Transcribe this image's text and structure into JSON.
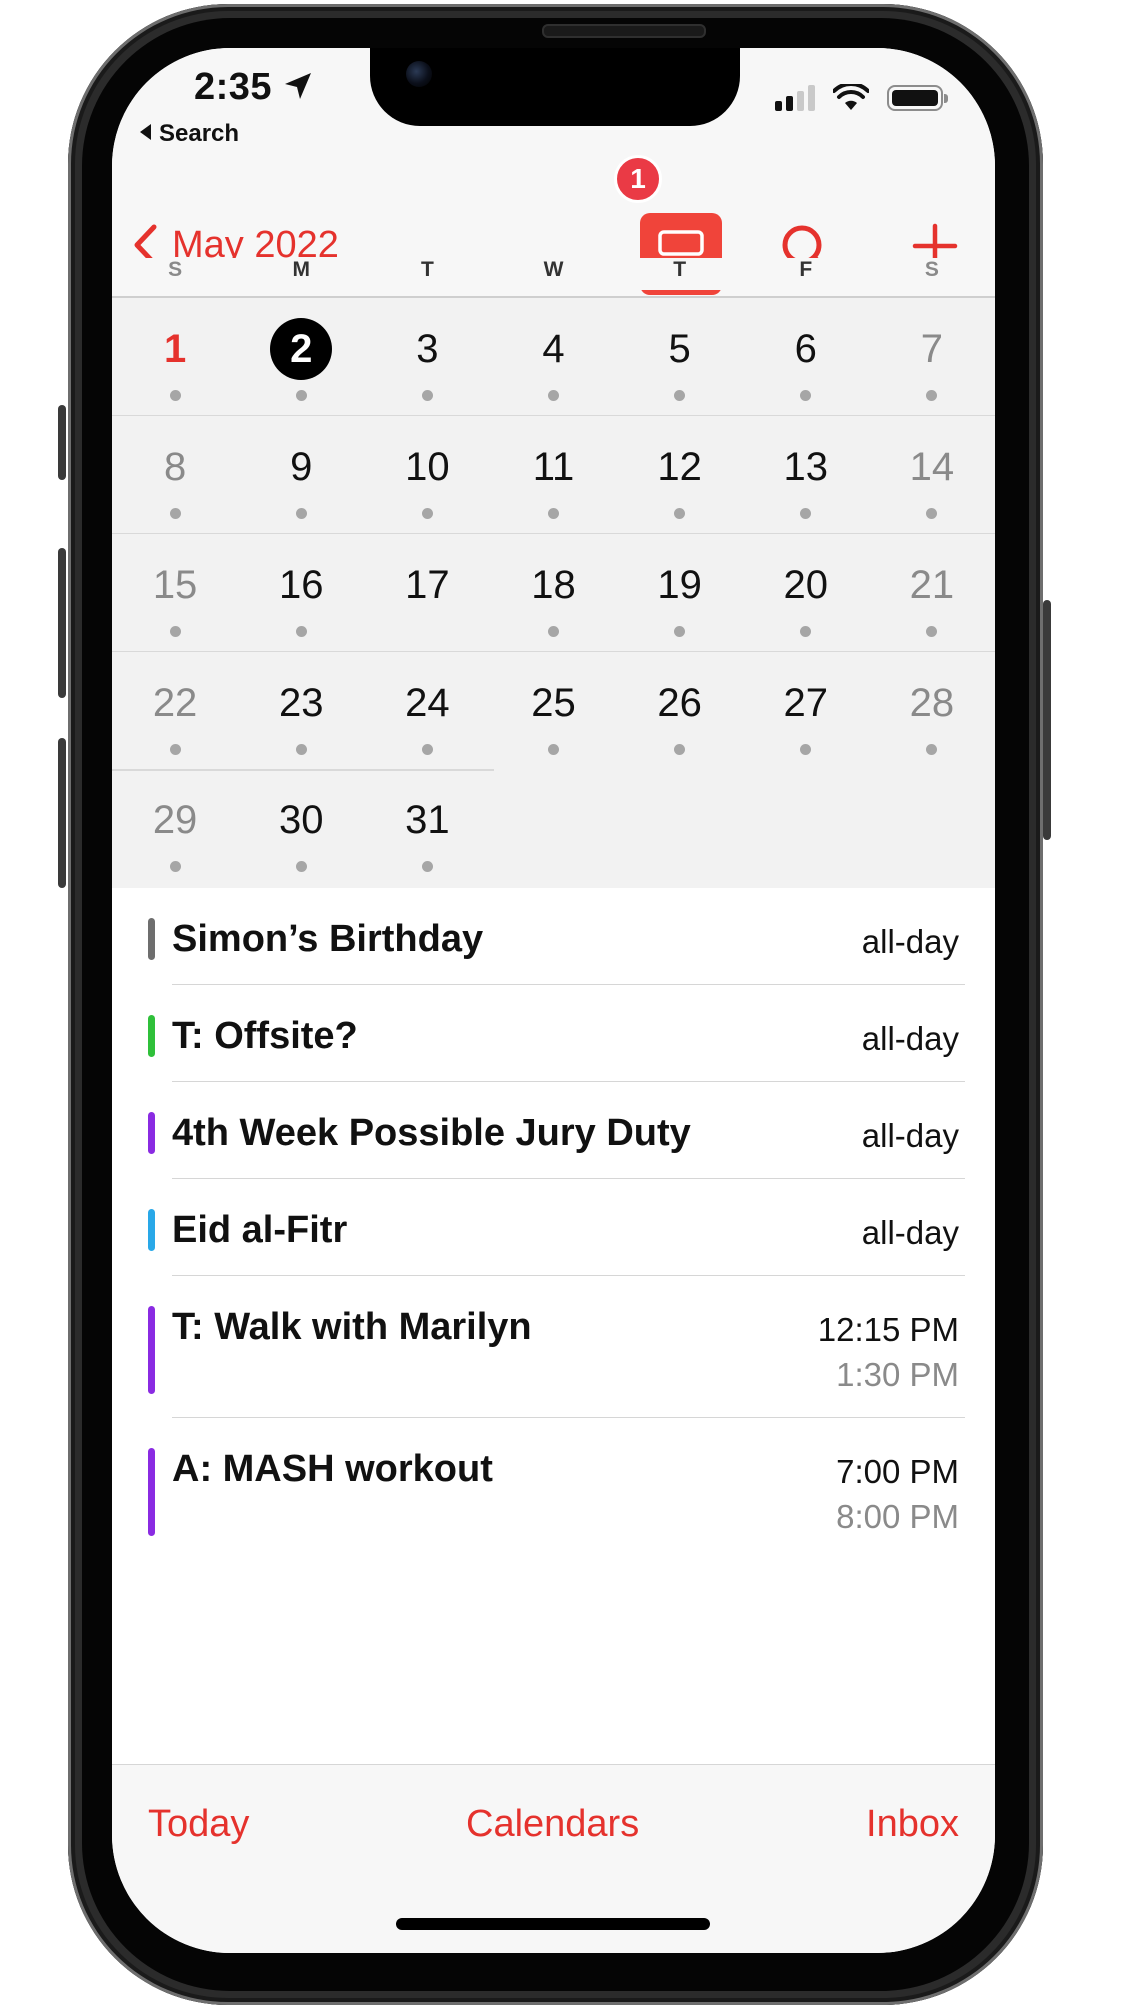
{
  "status_bar": {
    "time": "2:35",
    "back_app": "Search"
  },
  "nav": {
    "month_title": "May 2022",
    "badge_count": "1"
  },
  "weekdays": [
    "S",
    "M",
    "T",
    "W",
    "T",
    "F",
    "S"
  ],
  "month": {
    "weeks": [
      [
        "1",
        "2",
        "3",
        "4",
        "5",
        "6",
        "7"
      ],
      [
        "8",
        "9",
        "10",
        "11",
        "12",
        "13",
        "14"
      ],
      [
        "15",
        "16",
        "17",
        "18",
        "19",
        "20",
        "21"
      ],
      [
        "22",
        "23",
        "24",
        "25",
        "26",
        "27",
        "28"
      ],
      [
        "29",
        "30",
        "31"
      ]
    ],
    "selected_day": "2"
  },
  "events": [
    {
      "title": "Simon’s Birthday",
      "time1": "all-day",
      "time2": "",
      "color": "#6e6e6e"
    },
    {
      "title": "T: Offsite?",
      "time1": "all-day",
      "time2": "",
      "color": "#2fc03a"
    },
    {
      "title": "4th Week Possible Jury Duty",
      "time1": "all-day",
      "time2": "",
      "color": "#8a2be2"
    },
    {
      "title": "Eid al-Fitr",
      "time1": "all-day",
      "time2": "",
      "color": "#29a8e8"
    },
    {
      "title": "T: Walk with Marilyn",
      "time1": "12:15 PM",
      "time2": "1:30 PM",
      "color": "#8a2be2"
    },
    {
      "title": "A: MASH workout",
      "time1": "7:00 PM",
      "time2": "8:00 PM",
      "color": "#8a2be2"
    }
  ],
  "toolbar": {
    "today": "Today",
    "calendars": "Calendars",
    "inbox": "Inbox"
  },
  "colors": {
    "accent": "#e5322d",
    "today_circle": "#000000",
    "badge": "#ea3a45"
  },
  "icons": {
    "back": "chevron-left-icon",
    "list_toggle": "list-view-icon",
    "search": "search-icon",
    "add": "plus-icon",
    "location": "location-arrow-icon"
  }
}
